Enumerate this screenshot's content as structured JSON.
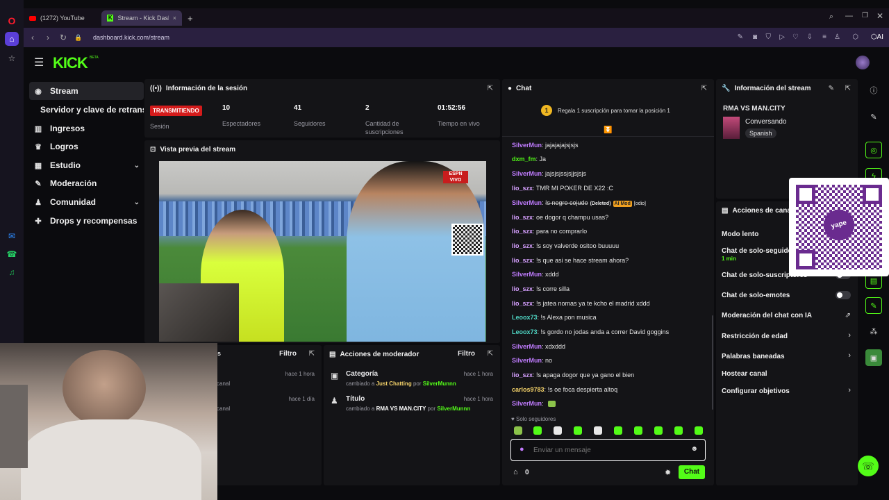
{
  "browser": {
    "tabs": [
      {
        "label": "(1272) YouTube"
      },
      {
        "label": "Stream - Kick Dash"
      }
    ],
    "url": "dashboard.kick.com/stream",
    "ai_label": "AI"
  },
  "topnav": {
    "logo": "KICK",
    "beta": "BETA"
  },
  "leftnav": {
    "items": [
      {
        "label": "Stream",
        "icon": "broadcast-icon"
      },
      {
        "label": "Servidor y clave de retransmisión",
        "icon": ""
      },
      {
        "label": "Ingresos",
        "icon": "chart-icon"
      },
      {
        "label": "Logros",
        "icon": "trophy-icon"
      },
      {
        "label": "Estudio",
        "icon": "studio-icon"
      },
      {
        "label": "Moderación",
        "icon": "wrench-icon"
      },
      {
        "label": "Comunidad",
        "icon": "users-icon"
      },
      {
        "label": "Drops y recompensas",
        "icon": "gift-icon"
      }
    ]
  },
  "session": {
    "title": "Información de la sesión",
    "live_badge": "TRANSMITIENDO",
    "session_label": "Sesión",
    "stats": [
      {
        "value": "10",
        "label": "Espectadores"
      },
      {
        "value": "41",
        "label": "Seguidores"
      },
      {
        "value": "2",
        "label": "Cantidad de suscripciones"
      },
      {
        "value": "01:52:56",
        "label": "Tiempo en vivo"
      }
    ]
  },
  "preview": {
    "title": "Vista previa del stream",
    "broadcaster": "ESPN",
    "broadcaster_sub": "VIVO"
  },
  "bottom_left": {
    "filter": "Filtro",
    "rows": [
      {
        "time": "hace 1 hora",
        "sub": "canal"
      },
      {
        "time": "hace 1 día",
        "sub": "canal"
      }
    ]
  },
  "mod_actions": {
    "title": "Acciones de moderador",
    "filter": "Filtro",
    "rows": [
      {
        "title": "Categoría",
        "prefix": "cambiado a",
        "value": "Just Chatting",
        "by": "por",
        "user": "SilverMunnn",
        "time": "hace 1 hora"
      },
      {
        "title": "Título",
        "prefix": "cambiado a",
        "value": "RMA VS MAN.CITY",
        "by": "por",
        "user": "SilverMunnn",
        "time": "hace 1 hora"
      }
    ]
  },
  "chat": {
    "title": "Chat",
    "gift_text": "Regala 1 suscripción para tomar la posición 1",
    "gift_rank": "1",
    "messages": [
      {
        "user": "SilverMun",
        "color": "#c07cff",
        "text": "jajajajajsjsjs"
      },
      {
        "user": "dxm_fm",
        "color": "#53fc18",
        "text": "Ja"
      },
      {
        "user": "SilverMun",
        "color": "#c07cff",
        "text": "jajsjsjssjsjjsjsjs"
      },
      {
        "user": "lio_szx",
        "color": "#d6a0ff",
        "text": "TMR MI POKER DE X22 :C"
      },
      {
        "user": "SilverMun",
        "color": "#c07cff",
        "text": "!s negro cojudo",
        "deleted": "(Deleted)",
        "tag": "AI Mod",
        "extra": "[odio]"
      },
      {
        "user": "lio_szx",
        "color": "#d6a0ff",
        "text": "oe dogor q champu usas?"
      },
      {
        "user": "lio_szx",
        "color": "#d6a0ff",
        "text": "para no comprarlo"
      },
      {
        "user": "lio_szx",
        "color": "#d6a0ff",
        "text": "!s soy valverde ositoo buuuuu"
      },
      {
        "user": "lio_szx",
        "color": "#d6a0ff",
        "text": "!s que asi se hace stream ahora?"
      },
      {
        "user": "SilverMun",
        "color": "#c07cff",
        "text": "xddd"
      },
      {
        "user": "lio_szx",
        "color": "#d6a0ff",
        "text": "!s corre silla"
      },
      {
        "user": "lio_szx",
        "color": "#d6a0ff",
        "text": "!s jatea nomas ya te kcho el madrid xddd"
      },
      {
        "user": "Leoox73",
        "color": "#4fd6c4",
        "text": "!s Alexa pon musica"
      },
      {
        "user": "Leoox73",
        "color": "#4fd6c4",
        "text": "!s gordo no jodas anda a correr David goggins"
      },
      {
        "user": "SilverMun",
        "color": "#c07cff",
        "text": "xdxddd"
      },
      {
        "user": "SilverMun",
        "color": "#c07cff",
        "text": "no"
      },
      {
        "user": "lio_szx",
        "color": "#d6a0ff",
        "text": "!s apaga dogor que ya gano el bien"
      },
      {
        "user": "carlos9783",
        "color": "#f5d36a",
        "text": "!s oe foca despierta altoq"
      },
      {
        "user": "SilverMun",
        "color": "#c07cff",
        "text": ""
      }
    ],
    "followers_only": "Solo seguidores",
    "placeholder": "Enviar un mensaje",
    "count": "0",
    "send_label": "Chat"
  },
  "stream_info": {
    "title": "Información del stream",
    "stream_title": "RMA VS MAN.CITY",
    "category": "Conversando",
    "language": "Spanish"
  },
  "channel_actions": {
    "title": "Acciones de canal",
    "items": [
      {
        "label": "Modo lento",
        "control": "toggle"
      },
      {
        "label": "Chat de solo-seguidores",
        "sub": "1 min",
        "control": "toggle"
      },
      {
        "label": "Chat de solo-suscriptores",
        "control": "toggle"
      },
      {
        "label": "Chat de solo-emotes",
        "control": "toggle"
      },
      {
        "label": "Moderación del chat con IA",
        "control": "link"
      },
      {
        "label": "Restricción de edad",
        "control": "chevron"
      },
      {
        "label": "Palabras baneadas",
        "control": "chevron"
      },
      {
        "label": "Hostear canal",
        "control": "none"
      },
      {
        "label": "Configurar objetivos",
        "control": "chevron"
      }
    ]
  },
  "qr": {
    "brand": "yape"
  },
  "colors": {
    "accent": "#53fc18",
    "panel": "#141417",
    "live": "#d41b1b"
  }
}
